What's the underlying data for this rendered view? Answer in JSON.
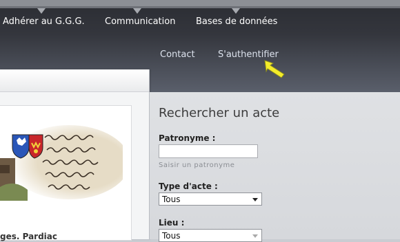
{
  "nav": {
    "primary": [
      {
        "label": "Adhérer au G.G.G."
      },
      {
        "label": "Communication"
      },
      {
        "label": "Bases de données"
      }
    ],
    "secondary": [
      {
        "label": "Contact"
      },
      {
        "label": "S'authentifier"
      }
    ]
  },
  "left_panel": {
    "caption": "ges. Pardiac"
  },
  "search": {
    "title": "Rechercher un acte",
    "surname_label": "Patronyme :",
    "surname_value": "",
    "surname_hint": "Saisir un patronyme",
    "act_type_label": "Type d'acte :",
    "act_type_value": "Tous",
    "place_label": "Lieu :",
    "place_value": "Tous"
  },
  "icons": {
    "cursor": "pointer-arrow-icon",
    "coat_of_arms": "coat-of-arms-icon"
  },
  "colors": {
    "nav_bg": "#34363d",
    "cursor": "#f3ec2a"
  }
}
